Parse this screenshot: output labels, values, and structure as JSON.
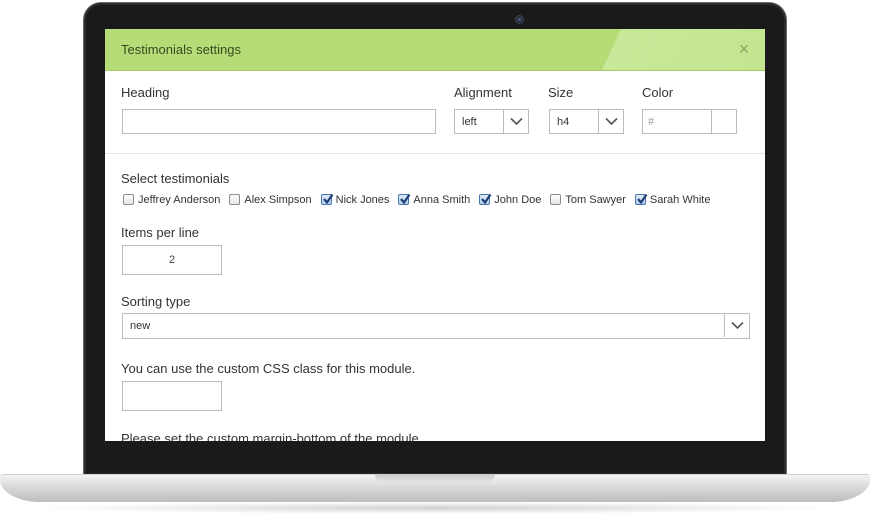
{
  "modal": {
    "title": "Testimonials settings",
    "close_glyph": "×"
  },
  "heading": {
    "label": "Heading",
    "value": ""
  },
  "alignment": {
    "label": "Alignment",
    "value": "left"
  },
  "size": {
    "label": "Size",
    "value": "h4"
  },
  "color": {
    "label": "Color",
    "value": "#"
  },
  "testimonials": {
    "label": "Select testimonials",
    "items": [
      {
        "name": "Jeffrey Anderson",
        "checked": false
      },
      {
        "name": "Alex Simpson",
        "checked": false
      },
      {
        "name": "Nick Jones",
        "checked": true
      },
      {
        "name": "Anna Smith",
        "checked": true
      },
      {
        "name": "John Doe",
        "checked": true
      },
      {
        "name": "Tom Sawyer",
        "checked": false
      },
      {
        "name": "Sarah White",
        "checked": true
      }
    ]
  },
  "items_per_line": {
    "label": "Items per line",
    "value": "2"
  },
  "sorting": {
    "label": "Sorting type",
    "value": "new"
  },
  "css_class": {
    "label": "You can use the custom CSS class for this module.",
    "value": ""
  },
  "margin_bottom": {
    "label": "Please set the custom margin-bottom of the module."
  },
  "colors": {
    "header_bg": "#b5dc77",
    "checkbox_checked": "#4a76b0"
  },
  "icons": {
    "close": "close-icon",
    "dropdown": "chevron-down-icon",
    "camera": "camera-icon"
  }
}
